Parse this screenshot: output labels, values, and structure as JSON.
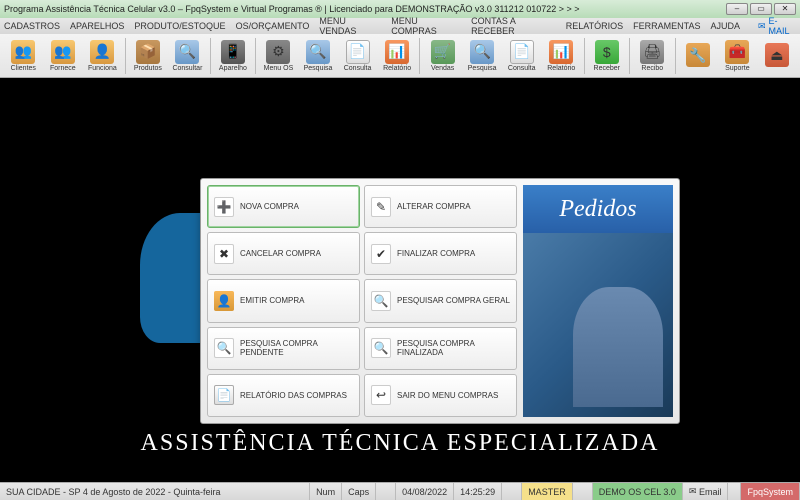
{
  "titlebar": {
    "title": "Programa Assistência Técnica Celular v3.0 – FpqSystem e Virtual Programas ® | Licenciado para  DEMONSTRAÇÃO v3.0 311212 010722 > > >"
  },
  "menubar": {
    "items": [
      "CADASTROS",
      "APARELHOS",
      "PRODUTO/ESTOQUE",
      "OS/ORÇAMENTO",
      "MENU VENDAS",
      "MENU COMPRAS",
      "CONTAS A RECEBER",
      "RELATÓRIOS",
      "FERRAMENTAS",
      "AJUDA"
    ],
    "email": "E-MAIL"
  },
  "toolbar": {
    "groups": [
      [
        {
          "label": "Clientes",
          "icon": "ic-people",
          "name": "clientes",
          "glyph": "👥"
        },
        {
          "label": "Fornece",
          "icon": "ic-people",
          "name": "fornecedores",
          "glyph": "👥"
        },
        {
          "label": "Funciona",
          "icon": "ic-people",
          "name": "funcionarios",
          "glyph": "👤"
        }
      ],
      [
        {
          "label": "Produtos",
          "icon": "ic-box",
          "name": "produtos",
          "glyph": "📦"
        },
        {
          "label": "Consultar",
          "icon": "ic-search",
          "name": "consultar-prod",
          "glyph": "🔍"
        }
      ],
      [
        {
          "label": "Aparelho",
          "icon": "ic-phone",
          "name": "aparelho",
          "glyph": "📱"
        }
      ],
      [
        {
          "label": "Menu OS",
          "icon": "ic-gear",
          "name": "menu-os",
          "glyph": "⚙"
        },
        {
          "label": "Pesquisa",
          "icon": "ic-search",
          "name": "pesquisa-os",
          "glyph": "🔍"
        },
        {
          "label": "Consulta",
          "icon": "ic-doc",
          "name": "consulta-os",
          "glyph": "📄"
        },
        {
          "label": "Relatório",
          "icon": "ic-chart",
          "name": "relatorio-os",
          "glyph": "📊"
        }
      ],
      [
        {
          "label": "Vendas",
          "icon": "ic-cart",
          "name": "vendas",
          "glyph": "🛒"
        },
        {
          "label": "Pesquisa",
          "icon": "ic-search",
          "name": "pesquisa-v",
          "glyph": "🔍"
        },
        {
          "label": "Consulta",
          "icon": "ic-doc",
          "name": "consulta-v",
          "glyph": "📄"
        },
        {
          "label": "Relatório",
          "icon": "ic-chart",
          "name": "relatorio-v",
          "glyph": "📊"
        }
      ],
      [
        {
          "label": "Receber",
          "icon": "ic-money",
          "name": "receber",
          "glyph": "$"
        }
      ],
      [
        {
          "label": "Recibo",
          "icon": "ic-printer",
          "name": "recibo",
          "glyph": "🖨"
        }
      ],
      [
        {
          "label": "",
          "icon": "ic-tools",
          "name": "ferramentas",
          "glyph": "🔧"
        },
        {
          "label": "Suporte",
          "icon": "ic-tools",
          "name": "suporte",
          "glyph": "🧰"
        },
        {
          "label": "",
          "icon": "ic-exit",
          "name": "sair",
          "glyph": "⏏"
        }
      ]
    ]
  },
  "background": {
    "text": "ASSISTÊNCIA TÉCNICA ESPECIALIZADA"
  },
  "dialog": {
    "title": "Pedidos",
    "buttons": [
      {
        "label": "NOVA COMPRA",
        "icon": "ic-add",
        "name": "nova-compra",
        "glyph": "➕",
        "selected": true
      },
      {
        "label": "ALTERAR COMPRA",
        "icon": "ic-edit",
        "name": "alterar-compra",
        "glyph": "✎"
      },
      {
        "label": "CANCELAR COMPRA",
        "icon": "ic-cancel",
        "name": "cancelar-compra",
        "glyph": "✖"
      },
      {
        "label": "FINALIZAR COMPRA",
        "icon": "ic-check",
        "name": "finalizar-compra",
        "glyph": "✔"
      },
      {
        "label": "EMITIR COMPRA",
        "icon": "ic-person",
        "name": "emitir-compra",
        "glyph": "👤"
      },
      {
        "label": "PESQUISAR COMPRA GERAL",
        "icon": "ic-mag",
        "name": "pesquisar-geral",
        "glyph": "🔍"
      },
      {
        "label": "PESQUISA COMPRA PENDENTE",
        "icon": "ic-mag",
        "name": "pesquisa-pendente",
        "glyph": "🔍"
      },
      {
        "label": "PESQUISA COMPRA FINALIZADA",
        "icon": "ic-mag",
        "name": "pesquisa-finalizada",
        "glyph": "🔍"
      },
      {
        "label": "RELATÓRIO DAS COMPRAS",
        "icon": "ic-doc",
        "name": "relatorio-compras",
        "glyph": "📄"
      },
      {
        "label": "SAIR DO MENU COMPRAS",
        "icon": "ic-out",
        "name": "sair-menu",
        "glyph": "↩"
      }
    ]
  },
  "statusbar": {
    "location": "SUA CIDADE - SP  4 de Agosto de 2022 - Quinta-feira",
    "num": "Num",
    "caps": "Caps",
    "date": "04/08/2022",
    "time": "14:25:29",
    "user": "MASTER",
    "demo": "DEMO OS CEL 3.0",
    "email": "Email",
    "brand": "FpqSystem"
  }
}
